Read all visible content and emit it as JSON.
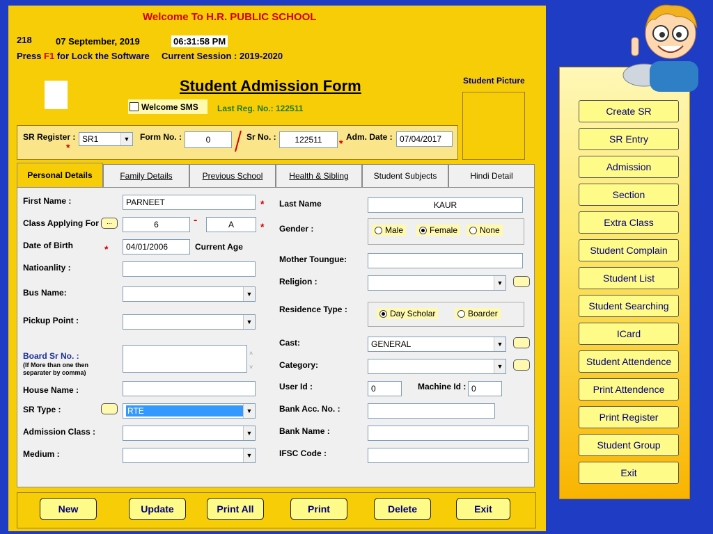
{
  "header": {
    "welcome": "Welcome To  H.R. PUBLIC SCHOOL",
    "code": "218",
    "date": "07 September, 2019",
    "time": "06:31:58 PM",
    "press": "Press",
    "key": "F1",
    "lock_text": "for Lock the Software",
    "session": "Current Session : 2019-2020"
  },
  "form": {
    "title": "Student Admission Form",
    "welcome_sms": "Welcome SMS",
    "last_reg": "Last Reg. No.: 122511",
    "picture_label": "Student Picture"
  },
  "sr_panel": {
    "sr_register_label": "SR Register :",
    "sr_register_value": "SR1",
    "form_no_label": "Form No. :",
    "form_no_value": "0",
    "sr_no_label": "Sr No. :",
    "sr_no_value": "122511",
    "adm_date_label": "Adm. Date :",
    "adm_date_value": "07/04/2017"
  },
  "tabs": [
    "Personal Details",
    "Family Details",
    "Previous School",
    "Health & Sibling",
    "Student Subjects",
    "Hindi Detail"
  ],
  "personal": {
    "first_name_label": "First Name :",
    "first_name": "PARNEET",
    "class_label": "Class Applying For",
    "class_btn": "...",
    "class_value": "6",
    "dash": "-",
    "section_value": "A",
    "dob_label": "Date of Birth",
    "dob": "04/01/2006",
    "current_age_label": "Current Age",
    "nationality_label": "Natioanlity :",
    "bus_label": "Bus Name:",
    "pickup_label": "Pickup Point :",
    "board_label": "Board Sr No. :",
    "board_note": "(If More than one then separater by comma)",
    "house_label": "House Name :",
    "srtype_label": "SR Type :",
    "srtype_value": "RTE",
    "adm_class_label": "Admission Class :",
    "medium_label": "Medium :",
    "last_name_label": "Last Name",
    "last_name": "KAUR",
    "gender_label": "Gender :",
    "gender_options": [
      "Male",
      "Female",
      "None"
    ],
    "gender_selected": "Female",
    "mother_tongue_label": "Mother Toungue:",
    "religion_label": "Religion :",
    "residence_label": "Residence Type :",
    "residence_options": [
      "Day Scholar",
      "Boarder"
    ],
    "residence_selected": "Day Scholar",
    "cast_label": "Cast:",
    "cast_value": "GENERAL",
    "category_label": "Category:",
    "user_id_label": "User Id :",
    "user_id": "0",
    "machine_id_label": "Machine Id :",
    "machine_id": "0",
    "bank_acc_label": "Bank Acc. No. :",
    "bank_name_label": "Bank Name :",
    "ifsc_label": "IFSC Code :"
  },
  "bottom_buttons": [
    "New",
    "Update",
    "Print All",
    "Print",
    "Delete",
    "Exit"
  ],
  "sidebar": [
    "Create SR",
    "SR Entry",
    "Admission",
    "Section",
    "Extra Class",
    "Student Complain",
    "Student List",
    "Student Searching",
    "ICard",
    "Student Attendence",
    "Print Attendence",
    "Print Register",
    "Student Group",
    "Exit"
  ],
  "colors": {
    "form_bg": "#f7cd08",
    "frame_bg": "#1f3cc4",
    "button_bg": "#fffb88",
    "accent_red": "#d20000"
  }
}
